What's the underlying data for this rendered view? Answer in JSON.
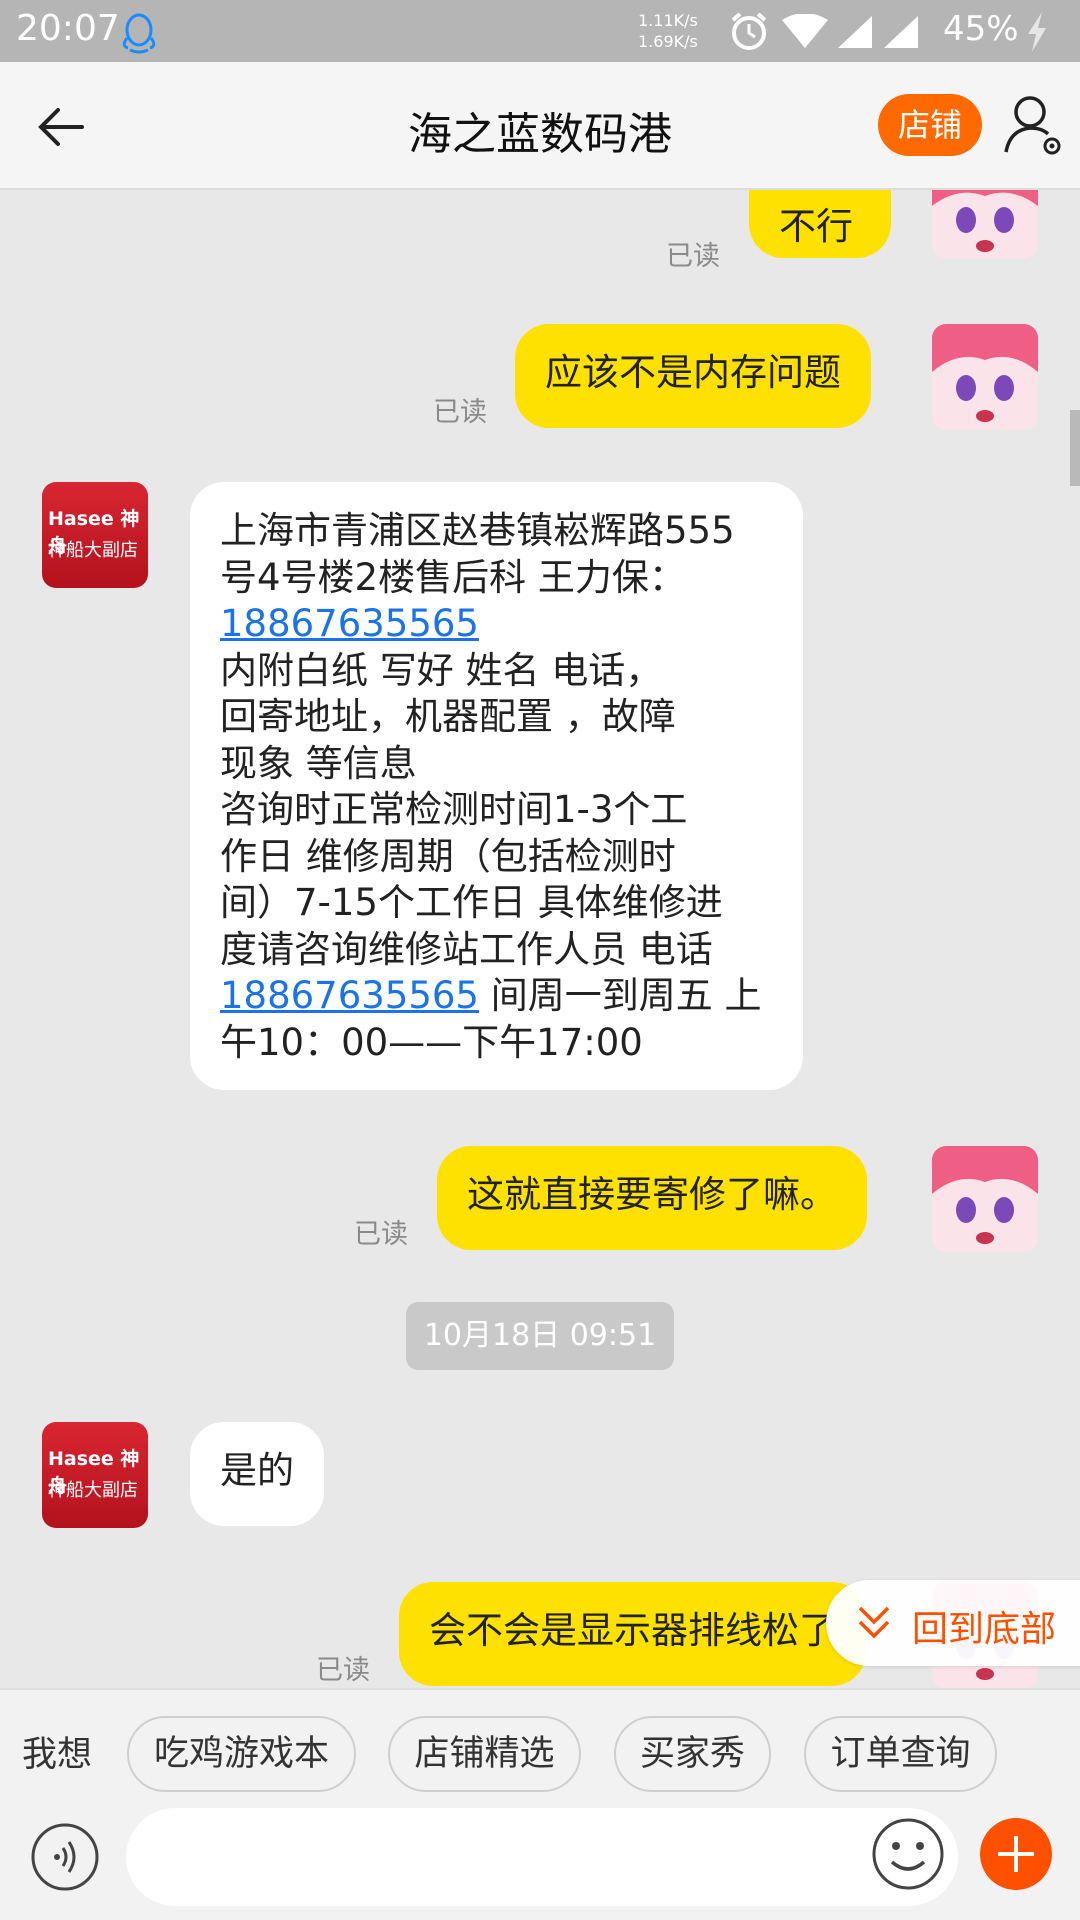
{
  "status_bar": {
    "time": "20:07",
    "speed_up": "1.11K/s",
    "speed_down": "1.69K/s",
    "battery": "45%",
    "icons": [
      "qq-penguin-icon",
      "alarm-icon",
      "wifi-icon",
      "signal-icon",
      "signal-icon",
      "charging-bolt-icon"
    ]
  },
  "nav": {
    "title": "海之蓝数码港",
    "shop_label": "店铺"
  },
  "shop_avatar": {
    "line1": "Hasee 神舟",
    "line2": "神船大副店"
  },
  "messages": {
    "m1": {
      "text": "不行",
      "read": "已读"
    },
    "m2": {
      "text": "应该不是内存问题",
      "read": "已读"
    },
    "m3": {
      "lines": [
        "上海市青浦区赵巷镇崧辉路555",
        "号4号楼2楼售后科 王力保：",
        "18867635565",
        " 内附白纸 写好 姓名 电话，",
        "回寄地址，机器配置 ，故障",
        "现象 等信息",
        "咨询时正常检测时间1-3个工",
        "作日 维修周期（包括检测时",
        "间）7-15个工作日 具体维修进",
        "度请咨询维修站工作人员 电话",
        "18867635565",
        " 间周一到周五 上",
        "午10：00——下午17:00"
      ]
    },
    "m4": {
      "text": "这就直接要寄修了嘛。",
      "read": "已读"
    },
    "timestamp": "10月18日 09:51",
    "m5": {
      "text": "是的"
    },
    "m6": {
      "text": "会不会是显示器排线松了",
      "read": "已读"
    }
  },
  "back_to_bottom": "回到底部",
  "quick_bar": {
    "label": "我想",
    "chips": [
      "吃鸡游戏本",
      "店铺精选",
      "买家秀",
      "订单查询"
    ]
  },
  "input": {
    "placeholder": ""
  },
  "colors": {
    "accent": "#ff6a00",
    "bubble_out": "#ffe100",
    "link": "#1a73e8"
  }
}
